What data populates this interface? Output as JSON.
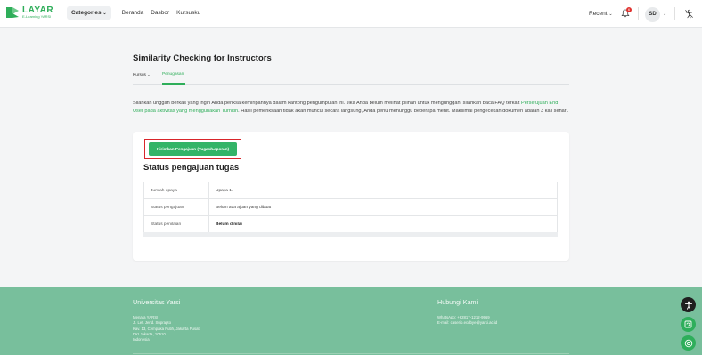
{
  "header": {
    "logo_title": "LAYAR",
    "logo_sub": "E-Learning YARSI",
    "nav_categories": "Categories",
    "nav_links": [
      "Beranda",
      "Dasbor",
      "Kursusku"
    ],
    "recent": "Recent",
    "notification_count": "6",
    "avatar_initials": "SD"
  },
  "page": {
    "title": "Similarity Checking for Instructors",
    "tabs": [
      "Kursus",
      "Penugasan"
    ],
    "intro_part1": "Silahkan unggah berkas yang ingin Anda periksa kemiripannya dalam kantong pengumpulan ini. Jika Anda belum melihat pilihan untuk mengunggah, silahkan baca FAQ terkait ",
    "intro_link": "Persetujuan End User pada aktivitas yang menggunakan Turnitin",
    "intro_part2": ". Hasil pemeriksaan tidak akan muncul secara langsung, Anda perlu menunggu beberapa menit. Maksimal pengecekan dokumen adalah 3 kali sehari.",
    "submit_button": "Kirimkan Pengajuan (Tugas/Laporan)",
    "status_heading": "Status pengajuan tugas",
    "status_rows": [
      {
        "label": "Jumlah upaya",
        "value": "Upaya 1."
      },
      {
        "label": "Status pengajuan",
        "value": "Belum ada ajuan yang dibuat"
      },
      {
        "label": "Status penilaian",
        "value": "Belum dinilai"
      }
    ]
  },
  "footer": {
    "university": "Universitas Yarsi",
    "address_lines": [
      "Menara YARSI",
      "Jl. Let. Jend. Suprapto",
      "Kav. 13, Cempaka Putih, Jakarta Pusat",
      "DKI Jakarta, 10510",
      "Indonesia"
    ],
    "contact_title": "Hubungi Kami",
    "contact_lines": [
      "WhatsApp: +62817-1212-9969",
      "E-mail: caserio.ecdbye@yarsi.ac.id"
    ]
  },
  "colors": {
    "brand_green": "#2fae5a",
    "footer_green": "#78bf9c",
    "highlight_red": "#d9262b"
  }
}
